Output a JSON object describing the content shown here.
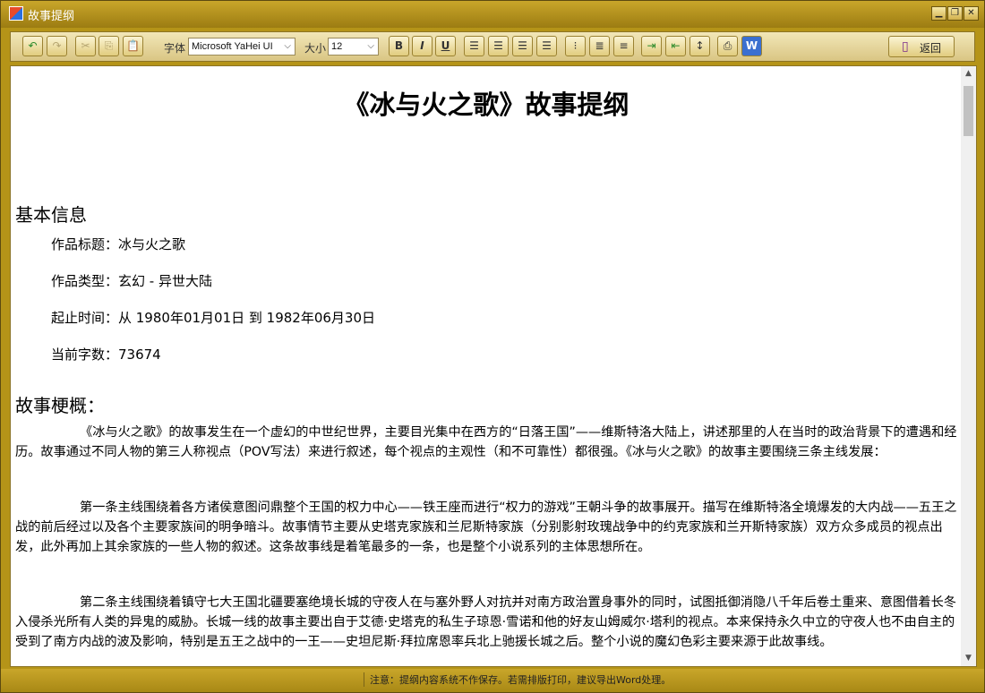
{
  "window": {
    "title": "故事提纲"
  },
  "toolbar": {
    "font_label": "字体",
    "font_value": "Microsoft YaHei UI",
    "size_label": "大小",
    "size_value": "12",
    "back_label": "返回"
  },
  "document": {
    "title": "《冰与火之歌》故事提纲",
    "section1": "基本信息",
    "info": [
      "作品标题：冰与火之歌",
      "作品类型：玄幻 - 异世大陆",
      "起止时间：从 1980年01月01日 到 1982年06月30日",
      "当前字数：73674"
    ],
    "section2": "故事梗概：",
    "paragraphs": [
      "《冰与火之歌》的故事发生在一个虚幻的中世纪世界，主要目光集中在西方的“日落王国”——维斯特洛大陆上，讲述那里的人在当时的政治背景下的遭遇和经历。故事通过不同人物的第三人称视点（POV写法）来进行叙述，每个视点的主观性（和不可靠性）都很强。《冰与火之歌》的故事主要围绕三条主线发展：",
      "第一条主线围绕着各方诸侯意图问鼎整个王国的权力中心——铁王座而进行“权力的游戏”王朝斗争的故事展开。描写在维斯特洛全境爆发的大内战——五王之战的前后经过以及各个主要家族间的明争暗斗。故事情节主要从史塔克家族和兰尼斯特家族（分别影射玫瑰战争中的约克家族和兰开斯特家族）双方众多成员的视点出发，此外再加上其余家族的一些人物的叙述。这条故事线是着笔最多的一条，也是整个小说系列的主体思想所在。",
      "第二条主线围绕着镇守七大王国北疆要塞绝境长城的守夜人在与塞外野人对抗并对南方政治置身事外的同时，试图抵御消隐八千年后卷土重来、意图借着长冬入侵杀光所有人类的异鬼的威胁。长城一线的故事主要出自于艾德·史塔克的私生子琼恩·雪诺和他的好友山姆威尔·塔利的视点。本来保持永久中立的守夜人也不由自主的受到了南方内战的波及影响，特别是五王之战中的一王——史坦尼斯·拜拉席恩率兵北上驰援长城之后。整个小说的魔幻色彩主要来源于此故事线。"
    ]
  },
  "status": {
    "note": "注意：提纲内容系统不作保存。若需排版打印，建议导出Word处理。"
  }
}
